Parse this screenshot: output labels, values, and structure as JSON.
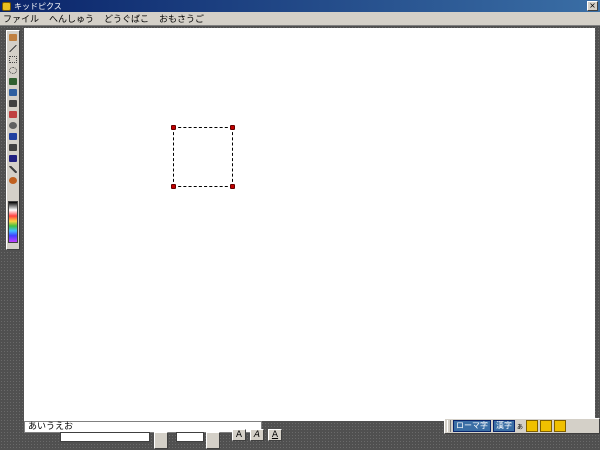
{
  "window": {
    "title": "キッドピクス",
    "close_label": "×"
  },
  "menubar": {
    "items": [
      {
        "label": "ファイル"
      },
      {
        "label": "へんしゅう"
      },
      {
        "label": "どうぐばこ"
      },
      {
        "label": "おもさうご"
      }
    ]
  },
  "toolbox": {
    "tools": [
      {
        "icon": "paint-tool-icon",
        "color": "#c08040"
      },
      {
        "icon": "line-tool-icon",
        "color": "#808080"
      },
      {
        "icon": "rectangle-tool-icon",
        "color": "#404040"
      },
      {
        "icon": "oval-tool-icon",
        "color": "#404040"
      },
      {
        "icon": "pencil-tool-icon",
        "color": "#306030"
      },
      {
        "icon": "spray-tool-icon",
        "color": "#3060a0"
      },
      {
        "icon": "fill-tool-icon",
        "color": "#404040"
      },
      {
        "icon": "eraser-tool-icon",
        "color": "#c04040"
      },
      {
        "icon": "stamp-tool-icon",
        "color": "#404040"
      },
      {
        "icon": "text-tool-icon",
        "color": "#2040a0"
      },
      {
        "icon": "select-tool-icon",
        "color": "#404040"
      },
      {
        "icon": "lasso-tool-icon",
        "color": "#202080"
      },
      {
        "icon": "eyedropper-tool-icon",
        "color": "#404040"
      },
      {
        "icon": "undo-tool-icon",
        "color": "#c06020"
      }
    ]
  },
  "fontbar": {
    "sample_text": "あいうえお"
  },
  "style_buttons": [
    {
      "label": "A",
      "name": "bold-style-button"
    },
    {
      "label": "A",
      "name": "outline-style-button"
    },
    {
      "label": "A",
      "name": "shadow-style-button"
    }
  ],
  "imebar": {
    "mode_label": "ローマ字",
    "kanji_label": "漢字",
    "small_label": "あ",
    "colors": {
      "accent": "#3a6ea5"
    }
  }
}
